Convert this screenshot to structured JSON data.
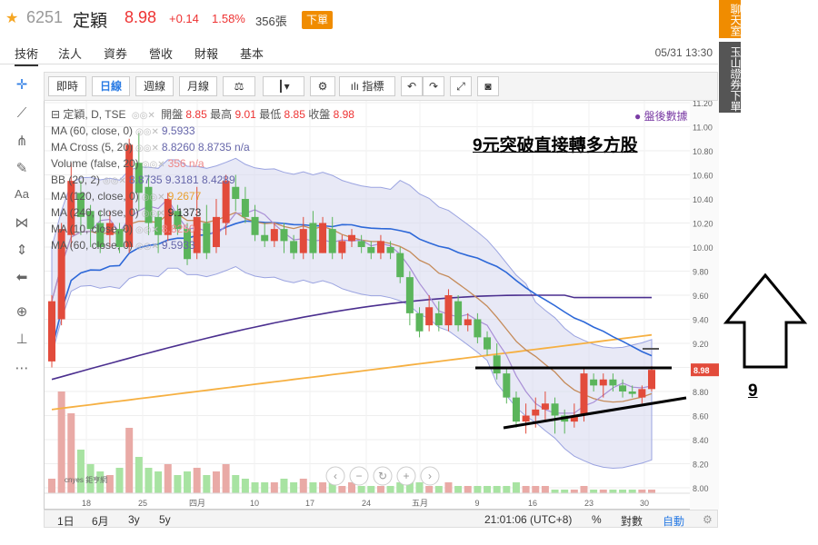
{
  "header": {
    "code": "6251",
    "name": "定穎",
    "price": "8.98",
    "change": "+0.14",
    "change_pct": "1.58%",
    "volume": "356張",
    "order_label": "下單"
  },
  "tabs": [
    "技術",
    "法人",
    "資券",
    "營收",
    "財報",
    "基本"
  ],
  "datetime": "05/31 13:30",
  "side": {
    "chat": "聊天室",
    "broker": "玉山證券下單"
  },
  "toolbar": [
    "即時",
    "日線",
    "週線",
    "月線",
    "指標"
  ],
  "legend": {
    "main": "定穎, D, TSE",
    "open_label": "開盤",
    "open": "8.85",
    "high_label": "最高",
    "high": "9.01",
    "low_label": "最低",
    "low": "8.85",
    "close_label": "收盤",
    "close": "8.98",
    "rows": [
      {
        "name": "MA (60, close, 0)",
        "value": "9.5933"
      },
      {
        "name": "MA Cross (5, 20)",
        "value": "8.8260  8.8735  n/a"
      },
      {
        "name": "Volume (false, 20)",
        "value": "356  n/a"
      },
      {
        "name": "BB (20, 2)",
        "value": "8.8735  9.3181  8.4289"
      },
      {
        "name": "MA (120, close, 0)",
        "value": "9.2677"
      },
      {
        "name": "MA (240, close, 0)",
        "value": "9.1373"
      },
      {
        "name": "MA (10, close, 0)",
        "value": "8.8250"
      },
      {
        "name": "MA (60, close, 0)",
        "value": "9.5933"
      }
    ]
  },
  "after_hours": "● 盤後數據",
  "annotation": "9元突破直接轉多方股",
  "annotation2": "9",
  "watermark": "cnyes 鉅亨網",
  "price_axis": [
    "11.20",
    "11.00",
    "10.80",
    "10.60",
    "10.40",
    "10.20",
    "10.00",
    "9.80",
    "9.60",
    "9.40",
    "9.20",
    "9.00",
    "8.80",
    "8.60",
    "8.40",
    "8.20",
    "8.00"
  ],
  "price_tag": "8.98",
  "date_axis": [
    {
      "label": "18"
    },
    {
      "label": "25"
    },
    {
      "label": "四月"
    },
    {
      "label": "10"
    },
    {
      "label": "17"
    },
    {
      "label": "24"
    },
    {
      "label": "五月"
    },
    {
      "label": "9"
    },
    {
      "label": "16"
    },
    {
      "label": "23"
    },
    {
      "label": "30"
    }
  ],
  "bottom": {
    "ranges": [
      "1日",
      "6月",
      "3y",
      "5y"
    ],
    "time": "21:01:06 (UTC+8)",
    "pct": "%",
    "log": "對數",
    "auto": "自動"
  },
  "colors": {
    "up": "#e24b3b",
    "down": "#5bb55b",
    "accent": "#f08c00",
    "band": "#d8daf0"
  }
}
